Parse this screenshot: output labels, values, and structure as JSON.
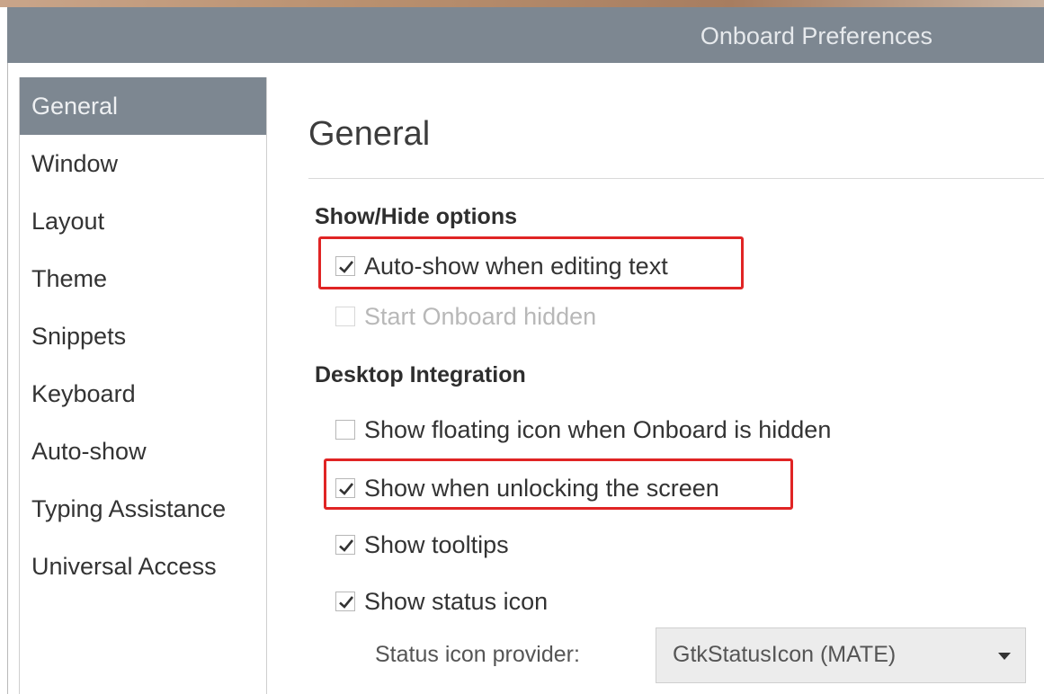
{
  "window": {
    "title": "Onboard Preferences"
  },
  "sidebar": {
    "items": [
      {
        "label": "General"
      },
      {
        "label": "Window"
      },
      {
        "label": "Layout"
      },
      {
        "label": "Theme"
      },
      {
        "label": "Snippets"
      },
      {
        "label": "Keyboard"
      },
      {
        "label": "Auto-show"
      },
      {
        "label": "Typing Assistance"
      },
      {
        "label": "Universal Access"
      }
    ],
    "selected": "General"
  },
  "main": {
    "page_title": "General",
    "show_hide": {
      "heading": "Show/Hide options",
      "auto_show": {
        "label": "Auto-show when editing text",
        "checked": true,
        "enabled": true
      },
      "start_hidden": {
        "label": "Start Onboard hidden",
        "checked": false,
        "enabled": false
      }
    },
    "desktop": {
      "heading": "Desktop Integration",
      "floating_icon": {
        "label": "Show floating icon when Onboard is hidden",
        "checked": false,
        "enabled": true
      },
      "unlocking": {
        "label": "Show when unlocking the screen",
        "checked": true,
        "enabled": true
      },
      "tooltips": {
        "label": "Show tooltips",
        "checked": true,
        "enabled": true
      },
      "status_icon": {
        "label": "Show status icon",
        "checked": true,
        "enabled": true
      },
      "provider_label": "Status icon provider:",
      "provider_value": "GtkStatusIcon (MATE)"
    }
  },
  "colors": {
    "titlebar": "#7d8791",
    "selection": "#7d8791",
    "highlight": "#e02424"
  }
}
